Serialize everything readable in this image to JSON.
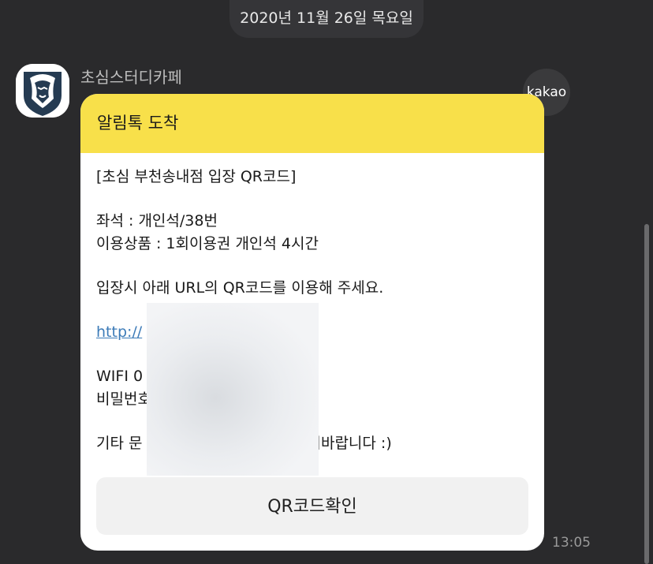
{
  "date_divider": "2020년 11월 26일 목요일",
  "sender": {
    "name": "초심스터디카페",
    "avatar_icon": "lion-logo-icon"
  },
  "badge": "kakao",
  "card": {
    "header": "알림톡 도착",
    "title_line": "[초심 부천송내점 입장 QR코드]",
    "seat_line": "좌석 : 개인석/38번",
    "product_line": "이용상품 : 1회이용권 개인석 4시간",
    "instruction_line": "입장시 아래 URL의 QR코드를 이용해 주세요.",
    "url_visible": "http://",
    "wifi_visible": "WIFI 0",
    "password_visible": "비밀번호",
    "other_prefix": "기타 문",
    "other_suffix": "로 문의바랍니다 :)",
    "button_label": "QR코드확인"
  },
  "timestamp": "13:05",
  "colors": {
    "background": "#2a2a2c",
    "header_yellow": "#f8e04a",
    "link": "#3c7bb8"
  }
}
